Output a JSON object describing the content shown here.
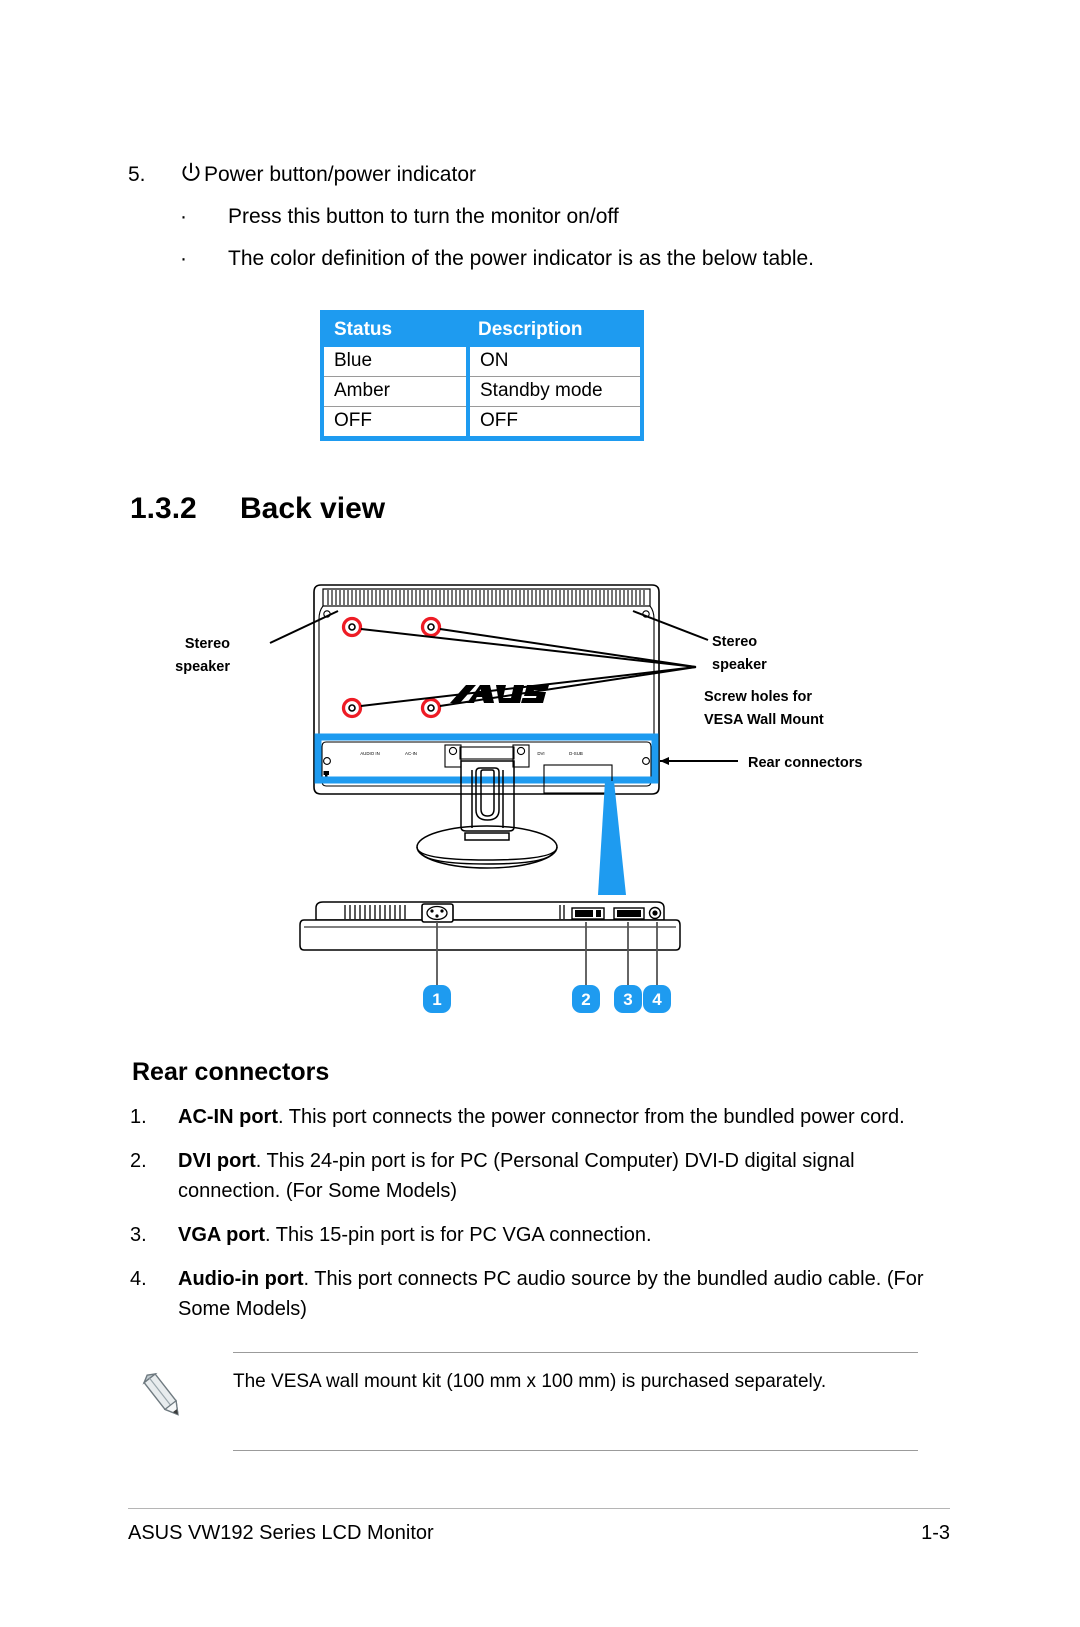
{
  "item5": {
    "number": "5.",
    "icon": "power-icon",
    "title": "Power button/power indicator",
    "bullets": [
      {
        "marker": "·",
        "text": "Press this button to turn the monitor on/off"
      },
      {
        "marker": "·",
        "text": "The color definition of the power indicator is as the below table."
      }
    ]
  },
  "status_table": {
    "accent_color": "#1e9bf0",
    "headers": [
      "Status",
      "Description"
    ],
    "rows": [
      [
        "Blue",
        "ON"
      ],
      [
        "Amber",
        "Standby mode"
      ],
      [
        "OFF",
        "OFF"
      ]
    ]
  },
  "section": {
    "number": "1.3.2",
    "title": "Back view"
  },
  "figure": {
    "brand_logo": "ASUS",
    "highlight_color": "#1e9bf0",
    "screw_color": "#ee1c25",
    "labels": {
      "left_speaker": [
        "Stereo",
        "speaker"
      ],
      "right_speaker": [
        "Stereo",
        "speaker"
      ],
      "vesa": [
        "Screw holes for",
        "VESA Wall Mount"
      ],
      "rear_connectors": "Rear connectors"
    },
    "port_labels": [
      "AUDIO IN",
      "AC-IN",
      "DVI",
      "D-SUB"
    ],
    "callouts": [
      "1",
      "2",
      "3",
      "4"
    ]
  },
  "rear_connectors": {
    "heading": "Rear connectors",
    "items": [
      {
        "number": "1.",
        "bold": "AC-IN port",
        "text": ". This port connects the power connector from the bundled power cord."
      },
      {
        "number": "2.",
        "bold": "DVI port",
        "text": ". This 24-pin port is for PC (Personal Computer) DVI-D digital signal connection. (For Some Models)"
      },
      {
        "number": "3.",
        "bold": "VGA port",
        "text": ". This 15-pin port is for PC VGA connection."
      },
      {
        "number": "4.",
        "bold": "Audio-in port",
        "text": ". This port connects PC audio source by the bundled audio cable. (For Some Models)"
      }
    ]
  },
  "note": {
    "icon": "pencil-icon",
    "text": "The VESA wall mount kit (100 mm x 100 mm) is purchased separately."
  },
  "footer": {
    "left": "ASUS VW192 Series LCD Monitor",
    "right": "1-3"
  }
}
